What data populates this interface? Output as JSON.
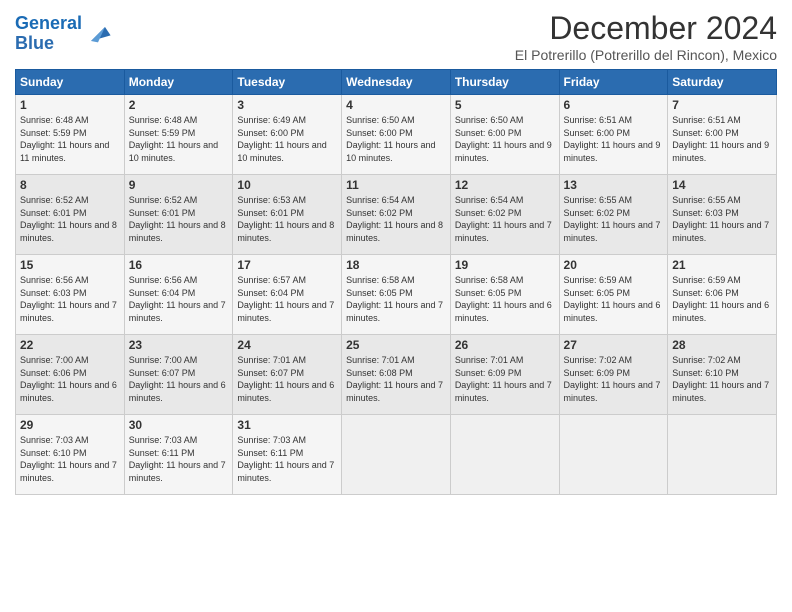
{
  "logo": {
    "line1": "General",
    "line2": "Blue"
  },
  "title": "December 2024",
  "location": "El Potrerillo (Potrerillo del Rincon), Mexico",
  "headers": [
    "Sunday",
    "Monday",
    "Tuesday",
    "Wednesday",
    "Thursday",
    "Friday",
    "Saturday"
  ],
  "weeks": [
    [
      {
        "day": "1",
        "rise": "6:48 AM",
        "set": "5:59 PM",
        "daylight": "11 hours and 11 minutes."
      },
      {
        "day": "2",
        "rise": "6:48 AM",
        "set": "5:59 PM",
        "daylight": "11 hours and 10 minutes."
      },
      {
        "day": "3",
        "rise": "6:49 AM",
        "set": "6:00 PM",
        "daylight": "11 hours and 10 minutes."
      },
      {
        "day": "4",
        "rise": "6:50 AM",
        "set": "6:00 PM",
        "daylight": "11 hours and 10 minutes."
      },
      {
        "day": "5",
        "rise": "6:50 AM",
        "set": "6:00 PM",
        "daylight": "11 hours and 9 minutes."
      },
      {
        "day": "6",
        "rise": "6:51 AM",
        "set": "6:00 PM",
        "daylight": "11 hours and 9 minutes."
      },
      {
        "day": "7",
        "rise": "6:51 AM",
        "set": "6:00 PM",
        "daylight": "11 hours and 9 minutes."
      }
    ],
    [
      {
        "day": "8",
        "rise": "6:52 AM",
        "set": "6:01 PM",
        "daylight": "11 hours and 8 minutes."
      },
      {
        "day": "9",
        "rise": "6:52 AM",
        "set": "6:01 PM",
        "daylight": "11 hours and 8 minutes."
      },
      {
        "day": "10",
        "rise": "6:53 AM",
        "set": "6:01 PM",
        "daylight": "11 hours and 8 minutes."
      },
      {
        "day": "11",
        "rise": "6:54 AM",
        "set": "6:02 PM",
        "daylight": "11 hours and 8 minutes."
      },
      {
        "day": "12",
        "rise": "6:54 AM",
        "set": "6:02 PM",
        "daylight": "11 hours and 7 minutes."
      },
      {
        "day": "13",
        "rise": "6:55 AM",
        "set": "6:02 PM",
        "daylight": "11 hours and 7 minutes."
      },
      {
        "day": "14",
        "rise": "6:55 AM",
        "set": "6:03 PM",
        "daylight": "11 hours and 7 minutes."
      }
    ],
    [
      {
        "day": "15",
        "rise": "6:56 AM",
        "set": "6:03 PM",
        "daylight": "11 hours and 7 minutes."
      },
      {
        "day": "16",
        "rise": "6:56 AM",
        "set": "6:04 PM",
        "daylight": "11 hours and 7 minutes."
      },
      {
        "day": "17",
        "rise": "6:57 AM",
        "set": "6:04 PM",
        "daylight": "11 hours and 7 minutes."
      },
      {
        "day": "18",
        "rise": "6:58 AM",
        "set": "6:05 PM",
        "daylight": "11 hours and 7 minutes."
      },
      {
        "day": "19",
        "rise": "6:58 AM",
        "set": "6:05 PM",
        "daylight": "11 hours and 6 minutes."
      },
      {
        "day": "20",
        "rise": "6:59 AM",
        "set": "6:05 PM",
        "daylight": "11 hours and 6 minutes."
      },
      {
        "day": "21",
        "rise": "6:59 AM",
        "set": "6:06 PM",
        "daylight": "11 hours and 6 minutes."
      }
    ],
    [
      {
        "day": "22",
        "rise": "7:00 AM",
        "set": "6:06 PM",
        "daylight": "11 hours and 6 minutes."
      },
      {
        "day": "23",
        "rise": "7:00 AM",
        "set": "6:07 PM",
        "daylight": "11 hours and 6 minutes."
      },
      {
        "day": "24",
        "rise": "7:01 AM",
        "set": "6:07 PM",
        "daylight": "11 hours and 6 minutes."
      },
      {
        "day": "25",
        "rise": "7:01 AM",
        "set": "6:08 PM",
        "daylight": "11 hours and 7 minutes."
      },
      {
        "day": "26",
        "rise": "7:01 AM",
        "set": "6:09 PM",
        "daylight": "11 hours and 7 minutes."
      },
      {
        "day": "27",
        "rise": "7:02 AM",
        "set": "6:09 PM",
        "daylight": "11 hours and 7 minutes."
      },
      {
        "day": "28",
        "rise": "7:02 AM",
        "set": "6:10 PM",
        "daylight": "11 hours and 7 minutes."
      }
    ],
    [
      {
        "day": "29",
        "rise": "7:03 AM",
        "set": "6:10 PM",
        "daylight": "11 hours and 7 minutes."
      },
      {
        "day": "30",
        "rise": "7:03 AM",
        "set": "6:11 PM",
        "daylight": "11 hours and 7 minutes."
      },
      {
        "day": "31",
        "rise": "7:03 AM",
        "set": "6:11 PM",
        "daylight": "11 hours and 7 minutes."
      },
      null,
      null,
      null,
      null
    ]
  ],
  "labels": {
    "sunrise": "Sunrise:",
    "sunset": "Sunset:",
    "daylight": "Daylight:"
  }
}
